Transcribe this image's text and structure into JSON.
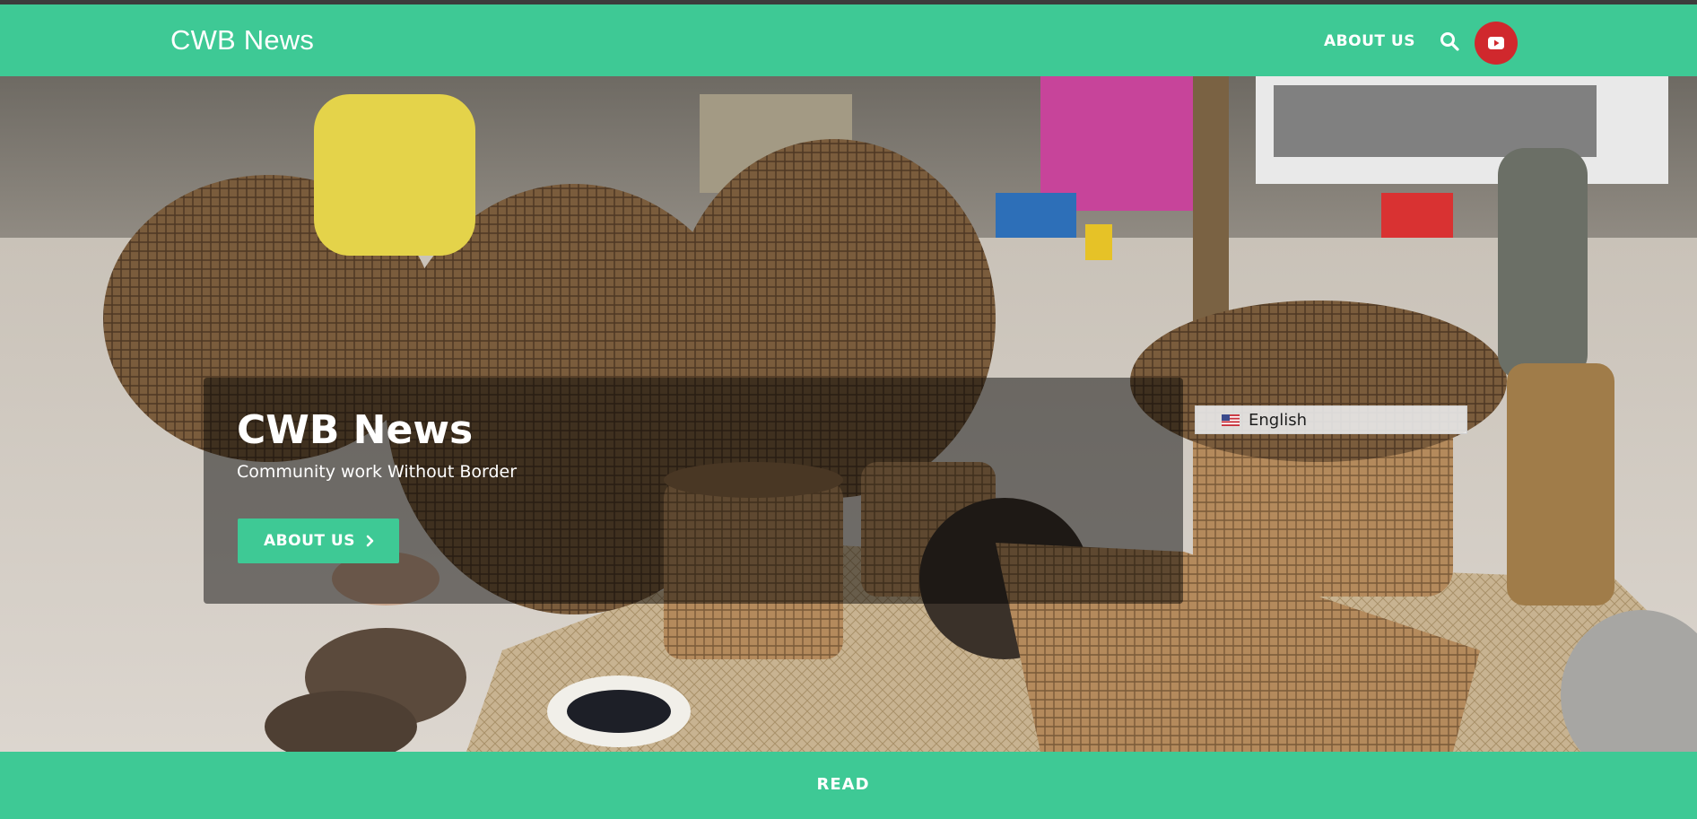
{
  "header": {
    "brand": "CWB News",
    "nav_about": "ABOUT US",
    "search_icon": "search-icon",
    "youtube_icon": "youtube-icon",
    "colors": {
      "bar": "#3ec995",
      "youtube": "#d0282d"
    }
  },
  "hero": {
    "background_image": "market-baskets-photo",
    "title": "CWB News",
    "subtitle": "Community work Without Border",
    "button_label": "ABOUT US",
    "button_icon": "chevron-right-icon"
  },
  "language": {
    "selected": "English",
    "flag_icon": "us-flag-icon"
  },
  "footer": {
    "read_label": "READ"
  }
}
